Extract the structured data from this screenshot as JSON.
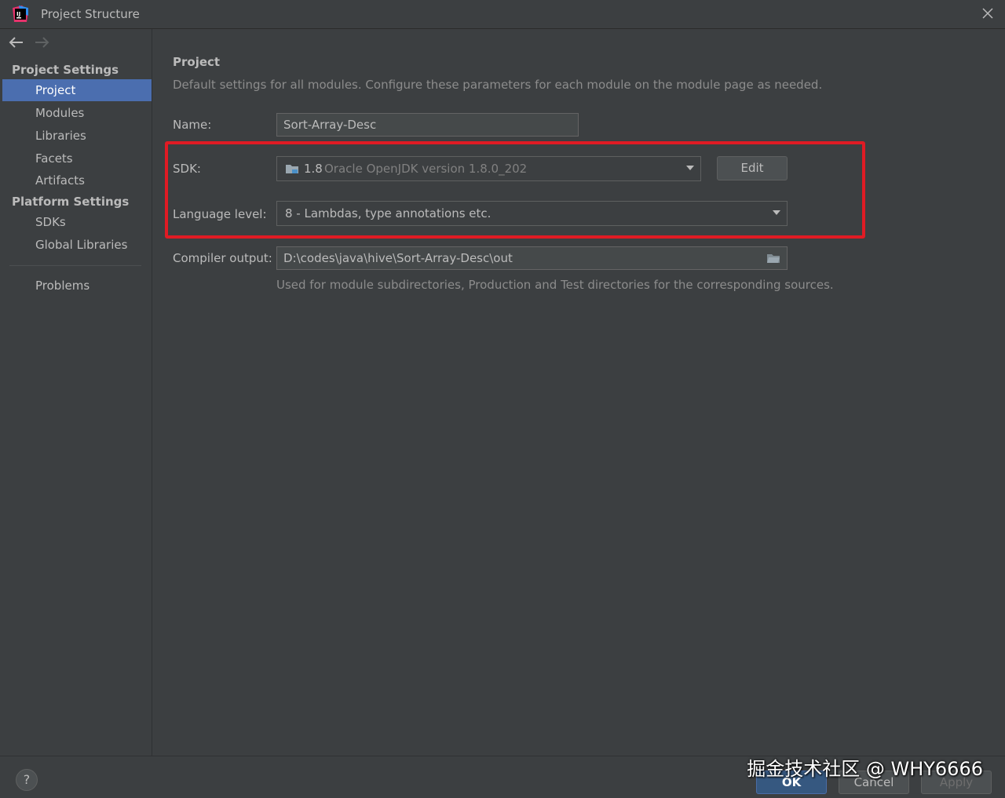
{
  "window": {
    "title": "Project Structure"
  },
  "sidebar": {
    "project_settings_header": "Project Settings",
    "project_items": [
      {
        "label": "Project",
        "selected": true
      },
      {
        "label": "Modules"
      },
      {
        "label": "Libraries"
      },
      {
        "label": "Facets"
      },
      {
        "label": "Artifacts"
      }
    ],
    "platform_settings_header": "Platform Settings",
    "platform_items": [
      {
        "label": "SDKs"
      },
      {
        "label": "Global Libraries"
      }
    ],
    "problems": "Problems"
  },
  "main": {
    "title": "Project",
    "description": "Default settings for all modules. Configure these parameters for each module on the module page as needed.",
    "name_label": "Name:",
    "name_value": "Sort-Array-Desc",
    "sdk_label": "SDK:",
    "sdk_version": "1.8",
    "sdk_detail": "Oracle OpenJDK version 1.8.0_202",
    "edit_button": "Edit",
    "language_label": "Language level:",
    "language_value": "8 - Lambdas, type annotations etc.",
    "compiler_label": "Compiler output:",
    "compiler_value": "D:\\codes\\java\\hive\\Sort-Array-Desc\\out",
    "compiler_hint": "Used for module subdirectories, Production and Test directories for the corresponding sources."
  },
  "footer": {
    "help": "?",
    "ok": "OK",
    "cancel": "Cancel",
    "apply": "Apply"
  },
  "watermark": "掘金技术社区 @ WHY6666",
  "colors": {
    "background": "#3c3f41",
    "selection": "#4b6eaf",
    "highlight": "#e01b24"
  }
}
